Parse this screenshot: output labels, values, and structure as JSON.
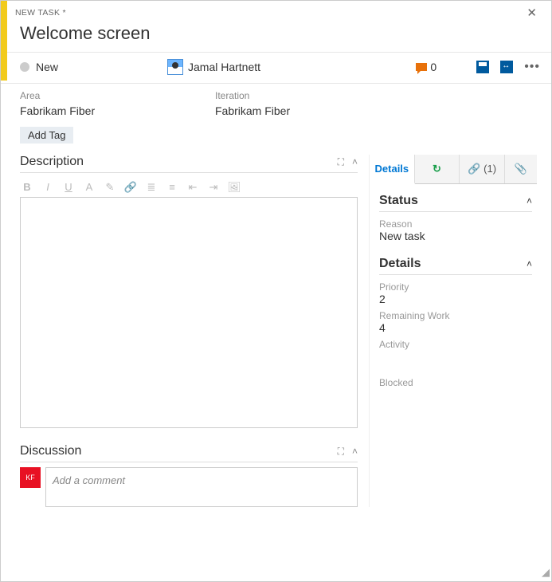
{
  "header": {
    "type_label": "NEW TASK *",
    "title": "Welcome screen"
  },
  "state": {
    "name": "New"
  },
  "assignee": {
    "name": "Jamal Hartnett"
  },
  "comments": {
    "count": "0"
  },
  "paths": {
    "area_label": "Area",
    "area_value": "Fabrikam Fiber",
    "iteration_label": "Iteration",
    "iteration_value": "Fabrikam Fiber"
  },
  "tags": {
    "add_label": "Add Tag"
  },
  "sections": {
    "description_title": "Description",
    "discussion_title": "Discussion"
  },
  "discussion": {
    "avatar_initials": "KF",
    "placeholder": "Add a comment"
  },
  "right_tabs": {
    "details": "Details",
    "links_label": "(1)"
  },
  "status_panel": {
    "title": "Status",
    "reason_label": "Reason",
    "reason_value": "New task"
  },
  "details_panel": {
    "title": "Details",
    "priority_label": "Priority",
    "priority_value": "2",
    "remaining_label": "Remaining Work",
    "remaining_value": "4",
    "activity_label": "Activity",
    "blocked_label": "Blocked"
  }
}
